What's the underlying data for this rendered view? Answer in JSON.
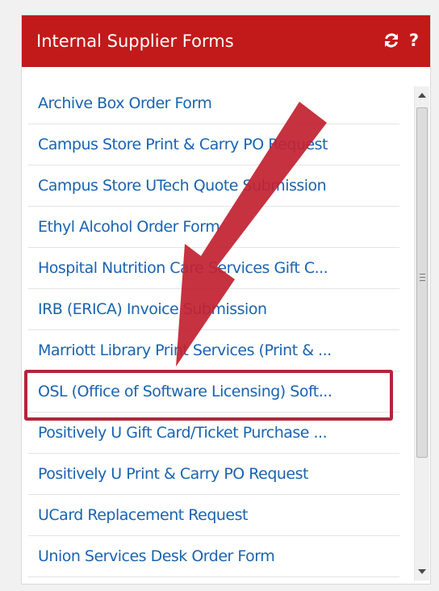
{
  "header": {
    "title": "Internal Supplier Forms",
    "icons": [
      "refresh-icon",
      "help-icon"
    ],
    "help_label": "?"
  },
  "forms": [
    "Archive Box Order Form",
    "Campus Store Print & Carry PO Request",
    "Campus Store UTech Quote Submission",
    "Ethyl Alcohol Order Form",
    "Hospital Nutrition Care Services Gift C...",
    "IRB (ERICA) Invoice Submission",
    "Marriott Library Print Services (Print & ...",
    "OSL (Office of Software Licensing) Soft...",
    "Positively U Gift Card/Ticket Purchase ...",
    "Positively U Print & Carry PO Request",
    "UCard Replacement Request",
    "Union Services Desk Order Form"
  ],
  "highlighted_index": 7,
  "colors": {
    "header_bg": "#c21a1a",
    "link": "#1a63b0",
    "highlight_border": "#b4243a",
    "arrow": "#c22232"
  }
}
